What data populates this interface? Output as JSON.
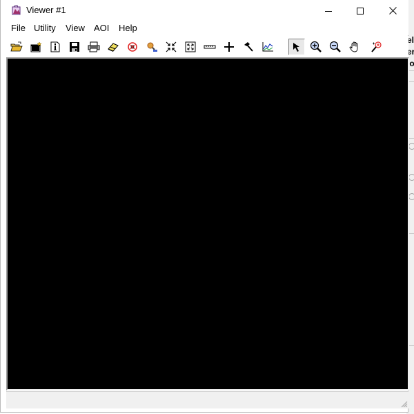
{
  "window": {
    "title": "Viewer #1",
    "controls": {
      "minimize": "minimize",
      "maximize": "maximize",
      "close": "close"
    }
  },
  "menu": [
    "File",
    "Utility",
    "View",
    "AOI",
    "Help"
  ],
  "toolbar": {
    "tools": [
      "open-icon",
      "new-viewer-icon",
      "info-icon",
      "save-icon",
      "print-icon",
      "erase-icon",
      "close-layer-icon",
      "inquire-icon",
      "fit-in-icon",
      "fit-extent-icon",
      "measure-icon",
      "cursor-crosshair-icon",
      "tools-icon",
      "profile-chart-icon",
      "select-arrow-icon",
      "zoom-in-icon",
      "zoom-out-icon",
      "pan-hand-icon",
      "magnify-icon"
    ],
    "active_tool": "select-arrow-icon"
  },
  "viewer": {
    "background": "#000000"
  },
  "background_app": {
    "fragments": [
      "el",
      "er",
      "lo"
    ]
  },
  "colors": {
    "accent": "#000000",
    "statusbar": "#f0f0f0",
    "frame": "#b9b9b9"
  }
}
